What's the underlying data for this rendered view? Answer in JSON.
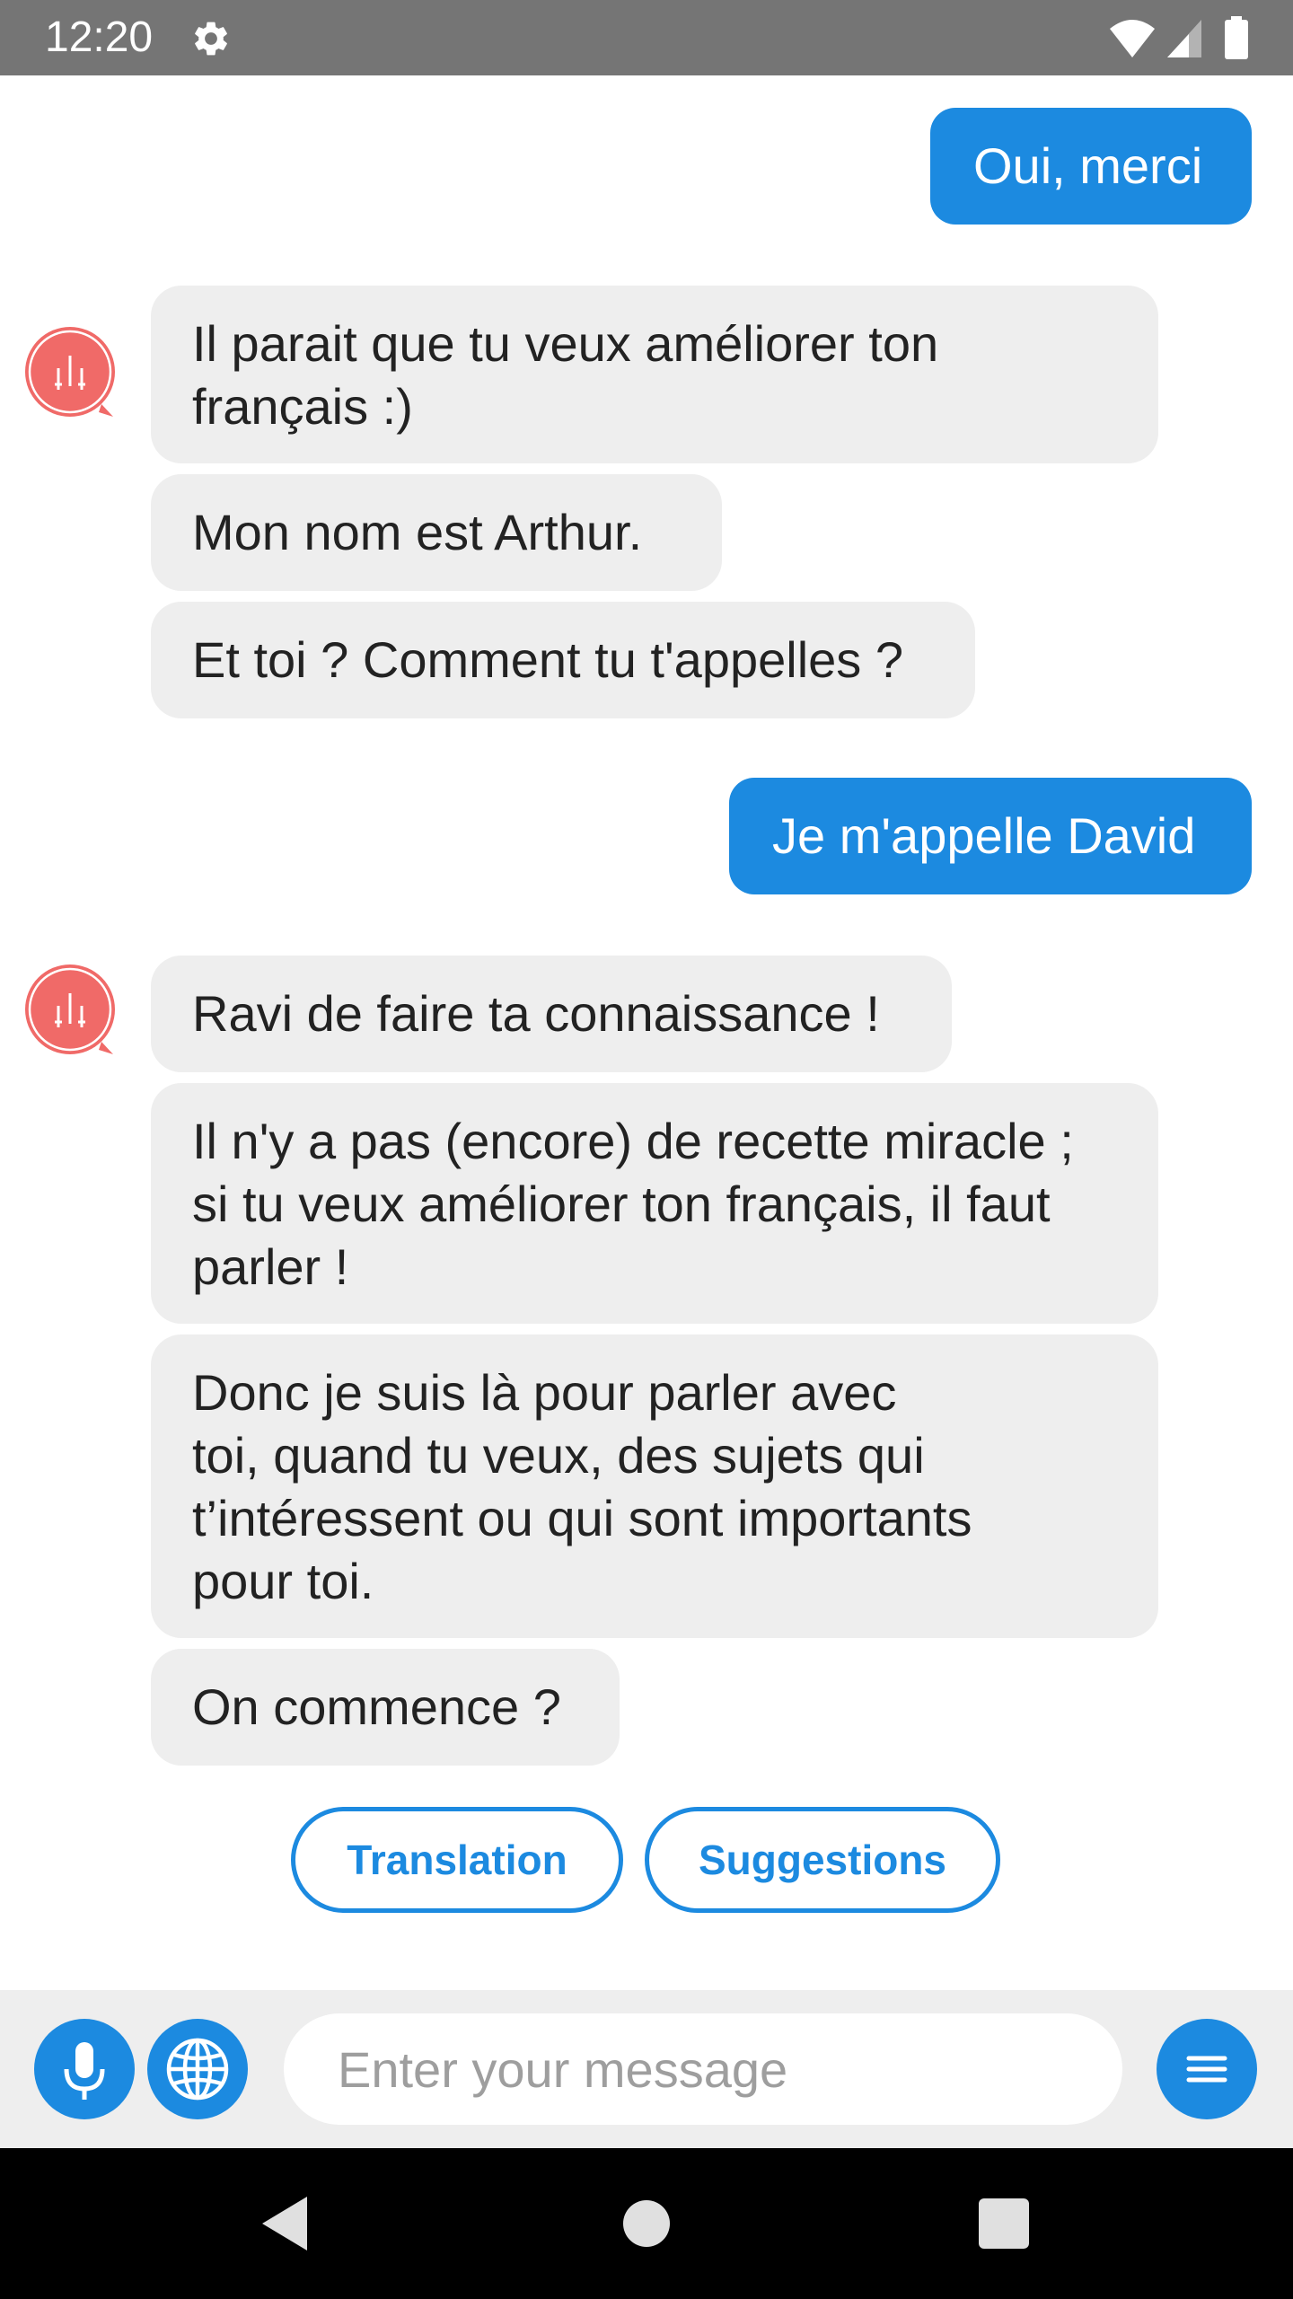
{
  "status_bar": {
    "time": "12:20",
    "icons": [
      "settings-icon",
      "wifi-icon",
      "signal-icon",
      "battery-icon"
    ]
  },
  "colors": {
    "accent": "#1c8ae0",
    "bot_bubble": "#eeeeee",
    "avatar": "#f06a68",
    "status_bar": "#757575"
  },
  "messages": [
    {
      "sender": "user",
      "text": "Oui, merci"
    },
    {
      "sender": "bot",
      "text": "Il parait que tu veux améliorer ton\nfrançais :)"
    },
    {
      "sender": "bot",
      "text": "Mon nom est Arthur."
    },
    {
      "sender": "bot",
      "text": "Et toi ? Comment tu t'appelles ?"
    },
    {
      "sender": "user",
      "text": "Je m'appelle David"
    },
    {
      "sender": "bot",
      "text": "Ravi de faire ta connaissance !"
    },
    {
      "sender": "bot",
      "text": "Il n'y a pas (encore) de recette miracle ;\nsi tu veux améliorer ton français, il faut\nparler !"
    },
    {
      "sender": "bot",
      "text": "Donc je suis là pour parler avec\ntoi, quand tu veux, des sujets qui\nt’intéressent ou qui sont importants\npour toi."
    },
    {
      "sender": "bot",
      "text": "On commence ?"
    }
  ],
  "quick_replies": [
    "Translation",
    "Suggestions"
  ],
  "input": {
    "placeholder": "Enter your message",
    "value": "",
    "left_buttons": [
      "microphone-icon",
      "globe-icon"
    ],
    "right_button": "menu-icon"
  },
  "nav": [
    "back-icon",
    "home-icon",
    "recents-icon"
  ]
}
